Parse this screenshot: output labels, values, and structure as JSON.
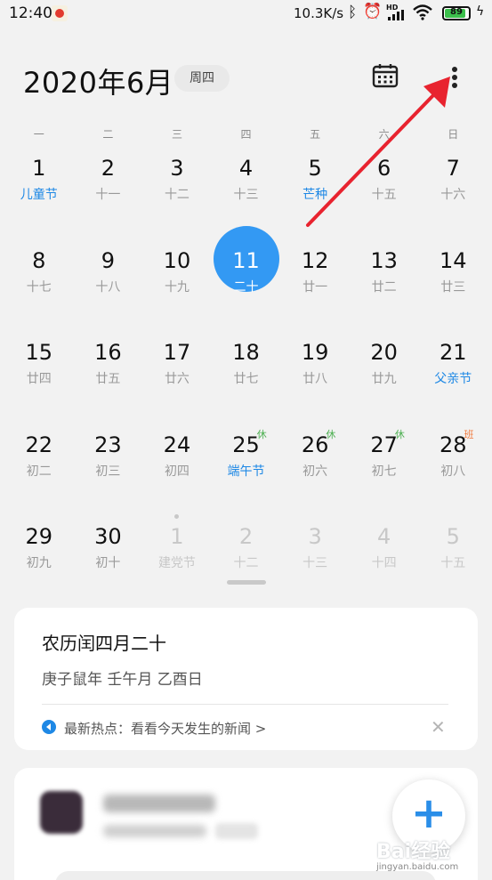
{
  "status_bar": {
    "time": "12:40",
    "network_speed": "10.3K/s",
    "battery": "89",
    "battery_level": 0.89,
    "icons": [
      "bluetooth-icon",
      "alarm-icon",
      "hd-icon",
      "signal-icon",
      "wifi-icon",
      "battery-icon",
      "charging-icon"
    ]
  },
  "header": {
    "title": "2020年6月",
    "weekday_badge": "周四",
    "calendar_icon": "calendar-icon",
    "more_icon": "more-vertical-icon"
  },
  "weekdays": [
    "一",
    "二",
    "三",
    "四",
    "五",
    "六",
    "日"
  ],
  "weeks": [
    [
      {
        "num": "1",
        "sub": "儿童节",
        "highlight": true
      },
      {
        "num": "2",
        "sub": "十一"
      },
      {
        "num": "3",
        "sub": "十二"
      },
      {
        "num": "4",
        "sub": "十三"
      },
      {
        "num": "5",
        "sub": "芒种",
        "highlight": true
      },
      {
        "num": "6",
        "sub": "十五"
      },
      {
        "num": "7",
        "sub": "十六"
      }
    ],
    [
      {
        "num": "8",
        "sub": "十七"
      },
      {
        "num": "9",
        "sub": "十八"
      },
      {
        "num": "10",
        "sub": "十九"
      },
      {
        "num": "11",
        "sub": "二十",
        "selected": true
      },
      {
        "num": "12",
        "sub": "廿一"
      },
      {
        "num": "13",
        "sub": "廿二"
      },
      {
        "num": "14",
        "sub": "廿三"
      }
    ],
    [
      {
        "num": "15",
        "sub": "廿四"
      },
      {
        "num": "16",
        "sub": "廿五"
      },
      {
        "num": "17",
        "sub": "廿六"
      },
      {
        "num": "18",
        "sub": "廿七"
      },
      {
        "num": "19",
        "sub": "廿八"
      },
      {
        "num": "20",
        "sub": "廿九"
      },
      {
        "num": "21",
        "sub": "父亲节",
        "highlight": true
      }
    ],
    [
      {
        "num": "22",
        "sub": "初二"
      },
      {
        "num": "23",
        "sub": "初三"
      },
      {
        "num": "24",
        "sub": "初四"
      },
      {
        "num": "25",
        "sub": "端午节",
        "highlight": true,
        "mark": "休"
      },
      {
        "num": "26",
        "sub": "初六",
        "mark": "休"
      },
      {
        "num": "27",
        "sub": "初七",
        "mark": "休"
      },
      {
        "num": "28",
        "sub": "初八",
        "mark": "班",
        "mark_type": "work"
      }
    ],
    [
      {
        "num": "29",
        "sub": "初九"
      },
      {
        "num": "30",
        "sub": "初十"
      },
      {
        "num": "1",
        "sub": "建党节",
        "faded": true,
        "dot": true
      },
      {
        "num": "2",
        "sub": "十二",
        "faded": true
      },
      {
        "num": "3",
        "sub": "十三",
        "faded": true
      },
      {
        "num": "4",
        "sub": "十四",
        "faded": true
      },
      {
        "num": "5",
        "sub": "十五",
        "faded": true
      }
    ]
  ],
  "lunar_card": {
    "title": "农历闰四月二十",
    "ganzhi": "庚子鼠年 壬午月 乙酉日",
    "news_text": "最新热点：看看今天发生的新闻 >",
    "close_icon": "close-icon",
    "news_icon": "speaker-icon"
  },
  "fab": {
    "label": "+"
  },
  "colors": {
    "accent": "#3399f3",
    "holiday_text": "#1e88e5",
    "rest_mark": "#4caf50",
    "work_mark": "#f07b3f",
    "annotation_arrow": "#e8232f"
  },
  "watermark": {
    "main": "Bai经验",
    "sub": "jingyan.baidu.com"
  }
}
